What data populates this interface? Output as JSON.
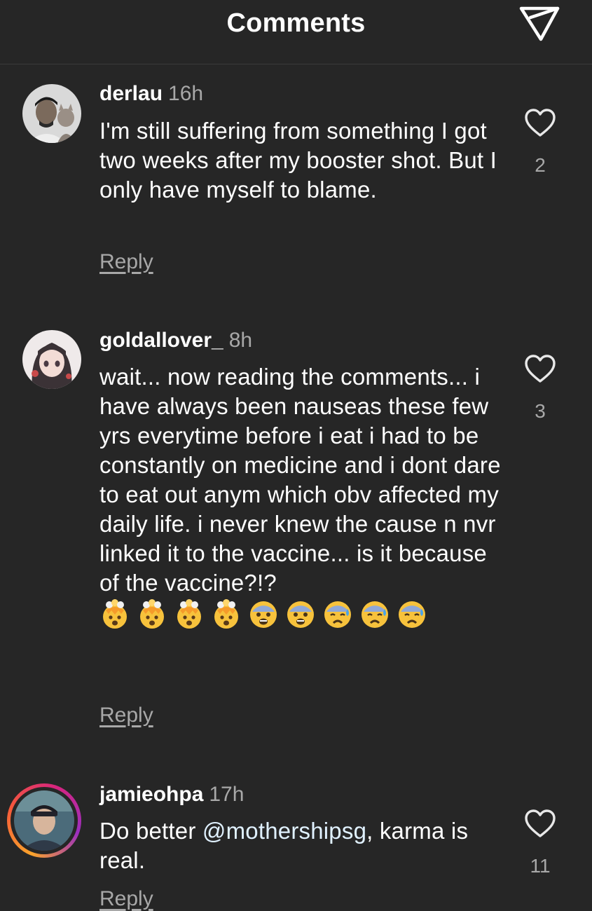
{
  "header": {
    "title": "Comments",
    "send_icon": "paper-plane-icon"
  },
  "comments": [
    {
      "username": "derlau",
      "time": "16h",
      "text": "I'm still suffering from something I got two weeks after my booster shot. But I only have myself to blame.",
      "likes": "2",
      "reply_label": "Reply"
    },
    {
      "username": "goldallover_",
      "time": "8h",
      "text": "wait... now reading the comments... i have always been nauseas these few yrs everytime before i eat i had to be constantly on medicine and i dont dare to eat out anym which obv affected my daily life. i never knew the cause n nvr linked it to the vaccine... is it because of the vaccine?!?",
      "emojis": [
        "🤯",
        "🤯",
        "🤯",
        "🤯",
        "😨",
        "😨",
        "😰",
        "😰",
        "😰"
      ],
      "likes": "3",
      "reply_label": "Reply"
    },
    {
      "username": "jamieohpa",
      "time": "17h",
      "text_before": "Do better ",
      "mention": "@mothershipsg",
      "text_after": ", karma is real.",
      "likes": "11",
      "reply_label": "Reply"
    }
  ],
  "colors": {
    "background": "#262626",
    "secondary_text": "#a8a8a8",
    "primary_text": "#ffffff"
  }
}
